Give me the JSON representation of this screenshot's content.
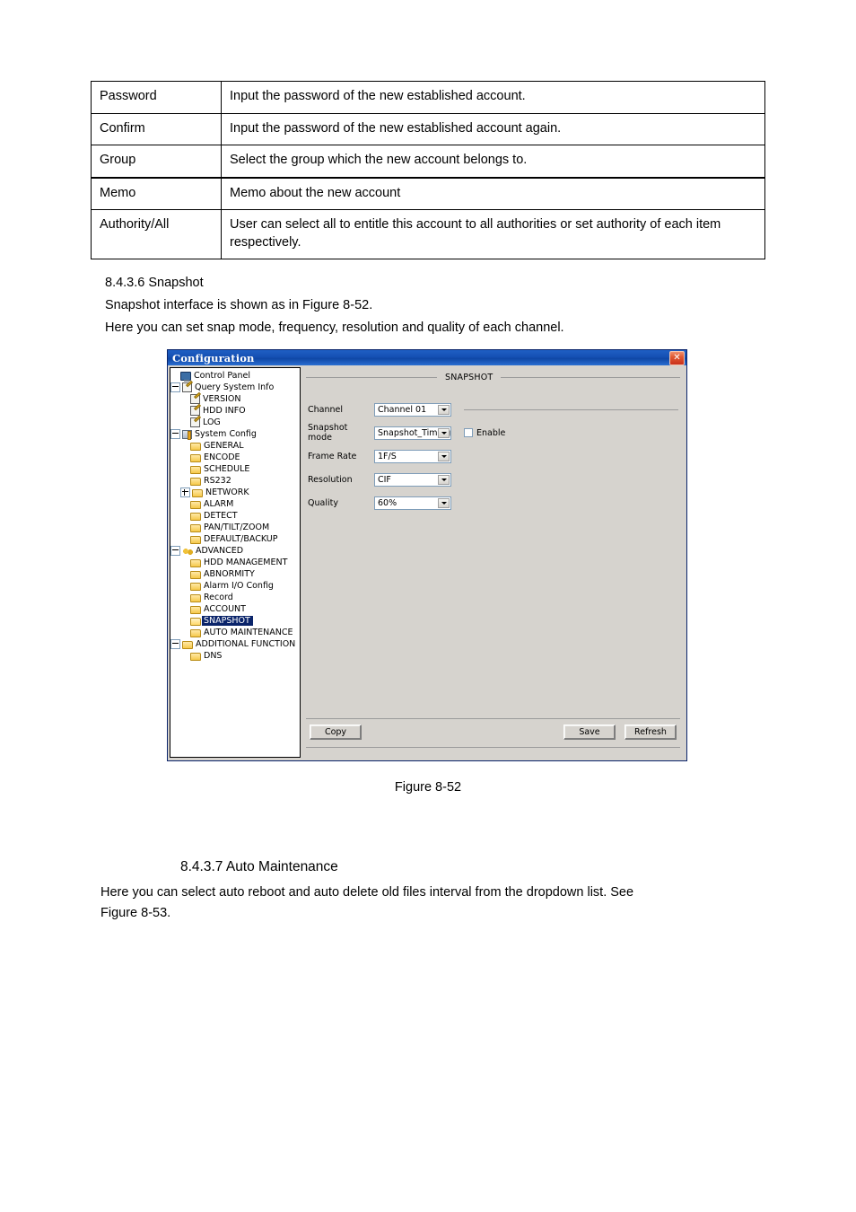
{
  "spec_table": {
    "rows": [
      {
        "term": "Password",
        "desc": "Input the password of the new established account."
      },
      {
        "term": "Confirm",
        "desc": "Input the password of the new established account again."
      },
      {
        "term": "Group",
        "desc": "Select the group which the new account belongs to."
      },
      {
        "term": "Memo",
        "desc": "Memo about the new account"
      },
      {
        "term": "Authority/All",
        "desc": "User can select all to entitle this account to all authorities or set authority of each item respectively."
      }
    ]
  },
  "sections": {
    "snapshot_heading": "8.4.3.6 Snapshot",
    "snapshot_line1": "Snapshot interface is shown as in Figure 8-52.",
    "snapshot_line2": "Here you can set snap mode, frequency, resolution and quality of each channel.",
    "figure_caption": "Figure 8-52",
    "auto_maintenance_heading": "8.4.3.7  Auto Maintenance",
    "auto_maintenance_body": "Here you can select auto reboot and auto delete old files interval from the dropdown list. See",
    "auto_maintenance_body_last": "Figure 8-53."
  },
  "dialog": {
    "title": "Configuration",
    "close_label": "✕",
    "tree": [
      {
        "label": "Control Panel",
        "indent": 0,
        "toggle": "none",
        "icon": "monitor-icon"
      },
      {
        "label": "Query System Info",
        "indent": 0,
        "toggle": "expanded",
        "icon": "note-icon"
      },
      {
        "label": "VERSION",
        "indent": 22,
        "toggle": "none",
        "icon": "note-icon"
      },
      {
        "label": "HDD INFO",
        "indent": 22,
        "toggle": "none",
        "icon": "note-icon"
      },
      {
        "label": "LOG",
        "indent": 22,
        "toggle": "none",
        "icon": "note-icon"
      },
      {
        "label": "System Config",
        "indent": 0,
        "toggle": "expanded",
        "icon": "tools-icon"
      },
      {
        "label": "GENERAL",
        "indent": 22,
        "toggle": "none",
        "icon": "folder-icon"
      },
      {
        "label": "ENCODE",
        "indent": 22,
        "toggle": "none",
        "icon": "folder-icon"
      },
      {
        "label": "SCHEDULE",
        "indent": 22,
        "toggle": "none",
        "icon": "folder-icon"
      },
      {
        "label": "RS232",
        "indent": 22,
        "toggle": "none",
        "icon": "folder-icon"
      },
      {
        "label": "NETWORK",
        "indent": 11,
        "toggle": "collapsed",
        "icon": "folder-icon"
      },
      {
        "label": "ALARM",
        "indent": 22,
        "toggle": "none",
        "icon": "folder-icon"
      },
      {
        "label": "DETECT",
        "indent": 22,
        "toggle": "none",
        "icon": "folder-icon"
      },
      {
        "label": "PAN/TILT/ZOOM",
        "indent": 22,
        "toggle": "none",
        "icon": "folder-icon"
      },
      {
        "label": "DEFAULT/BACKUP",
        "indent": 22,
        "toggle": "none",
        "icon": "folder-icon"
      },
      {
        "label": "ADVANCED",
        "indent": 0,
        "toggle": "expanded",
        "icon": "gear-icon"
      },
      {
        "label": "HDD MANAGEMENT",
        "indent": 22,
        "toggle": "none",
        "icon": "folder-icon"
      },
      {
        "label": "ABNORMITY",
        "indent": 22,
        "toggle": "none",
        "icon": "folder-icon"
      },
      {
        "label": "Alarm I/O Config",
        "indent": 22,
        "toggle": "none",
        "icon": "folder-icon"
      },
      {
        "label": "Record",
        "indent": 22,
        "toggle": "none",
        "icon": "folder-icon"
      },
      {
        "label": "ACCOUNT",
        "indent": 22,
        "toggle": "none",
        "icon": "folder-icon"
      },
      {
        "label": "SNAPSHOT",
        "indent": 22,
        "toggle": "none",
        "icon": "folder-open-icon",
        "selected": true
      },
      {
        "label": "AUTO MAINTENANCE",
        "indent": 22,
        "toggle": "none",
        "icon": "folder-icon"
      },
      {
        "label": "ADDITIONAL FUNCTION",
        "indent": 0,
        "toggle": "expanded",
        "icon": "folder-icon"
      },
      {
        "label": "DNS",
        "indent": 22,
        "toggle": "none",
        "icon": "folder-icon"
      }
    ],
    "panel": {
      "group_title": "SNAPSHOT",
      "fields": {
        "channel_label": "Channel",
        "channel_value": "Channel 01",
        "mode_label": "Snapshot mode",
        "mode_value": "Snapshot_Timing",
        "frame_label": "Frame Rate",
        "frame_value": "1F/S",
        "resolution_label": "Resolution",
        "resolution_value": "CIF",
        "quality_label": "Quality",
        "quality_value": "60%",
        "enable_label": "Enable"
      },
      "buttons": {
        "copy": "Copy",
        "save": "Save",
        "refresh": "Refresh"
      }
    }
  }
}
